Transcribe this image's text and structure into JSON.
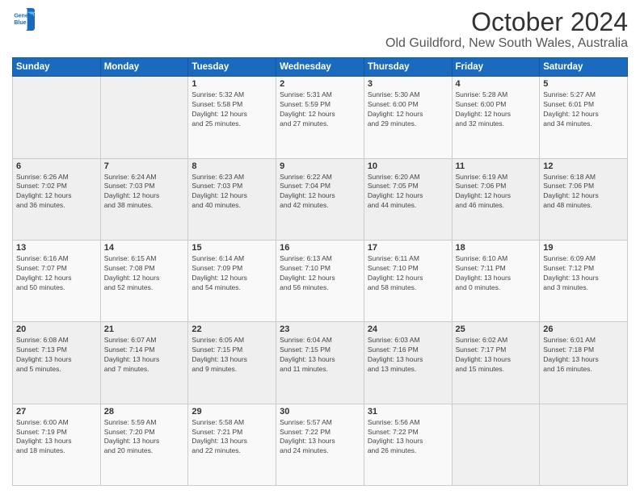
{
  "logo": {
    "line1": "General",
    "line2": "Blue"
  },
  "title": "October 2024",
  "subtitle": "Old Guildford, New South Wales, Australia",
  "weekdays": [
    "Sunday",
    "Monday",
    "Tuesday",
    "Wednesday",
    "Thursday",
    "Friday",
    "Saturday"
  ],
  "weeks": [
    [
      {
        "day": "",
        "text": ""
      },
      {
        "day": "",
        "text": ""
      },
      {
        "day": "1",
        "text": "Sunrise: 5:32 AM\nSunset: 5:58 PM\nDaylight: 12 hours\nand 25 minutes."
      },
      {
        "day": "2",
        "text": "Sunrise: 5:31 AM\nSunset: 5:59 PM\nDaylight: 12 hours\nand 27 minutes."
      },
      {
        "day": "3",
        "text": "Sunrise: 5:30 AM\nSunset: 6:00 PM\nDaylight: 12 hours\nand 29 minutes."
      },
      {
        "day": "4",
        "text": "Sunrise: 5:28 AM\nSunset: 6:00 PM\nDaylight: 12 hours\nand 32 minutes."
      },
      {
        "day": "5",
        "text": "Sunrise: 5:27 AM\nSunset: 6:01 PM\nDaylight: 12 hours\nand 34 minutes."
      }
    ],
    [
      {
        "day": "6",
        "text": "Sunrise: 6:26 AM\nSunset: 7:02 PM\nDaylight: 12 hours\nand 36 minutes."
      },
      {
        "day": "7",
        "text": "Sunrise: 6:24 AM\nSunset: 7:03 PM\nDaylight: 12 hours\nand 38 minutes."
      },
      {
        "day": "8",
        "text": "Sunrise: 6:23 AM\nSunset: 7:03 PM\nDaylight: 12 hours\nand 40 minutes."
      },
      {
        "day": "9",
        "text": "Sunrise: 6:22 AM\nSunset: 7:04 PM\nDaylight: 12 hours\nand 42 minutes."
      },
      {
        "day": "10",
        "text": "Sunrise: 6:20 AM\nSunset: 7:05 PM\nDaylight: 12 hours\nand 44 minutes."
      },
      {
        "day": "11",
        "text": "Sunrise: 6:19 AM\nSunset: 7:06 PM\nDaylight: 12 hours\nand 46 minutes."
      },
      {
        "day": "12",
        "text": "Sunrise: 6:18 AM\nSunset: 7:06 PM\nDaylight: 12 hours\nand 48 minutes."
      }
    ],
    [
      {
        "day": "13",
        "text": "Sunrise: 6:16 AM\nSunset: 7:07 PM\nDaylight: 12 hours\nand 50 minutes."
      },
      {
        "day": "14",
        "text": "Sunrise: 6:15 AM\nSunset: 7:08 PM\nDaylight: 12 hours\nand 52 minutes."
      },
      {
        "day": "15",
        "text": "Sunrise: 6:14 AM\nSunset: 7:09 PM\nDaylight: 12 hours\nand 54 minutes."
      },
      {
        "day": "16",
        "text": "Sunrise: 6:13 AM\nSunset: 7:10 PM\nDaylight: 12 hours\nand 56 minutes."
      },
      {
        "day": "17",
        "text": "Sunrise: 6:11 AM\nSunset: 7:10 PM\nDaylight: 12 hours\nand 58 minutes."
      },
      {
        "day": "18",
        "text": "Sunrise: 6:10 AM\nSunset: 7:11 PM\nDaylight: 13 hours\nand 0 minutes."
      },
      {
        "day": "19",
        "text": "Sunrise: 6:09 AM\nSunset: 7:12 PM\nDaylight: 13 hours\nand 3 minutes."
      }
    ],
    [
      {
        "day": "20",
        "text": "Sunrise: 6:08 AM\nSunset: 7:13 PM\nDaylight: 13 hours\nand 5 minutes."
      },
      {
        "day": "21",
        "text": "Sunrise: 6:07 AM\nSunset: 7:14 PM\nDaylight: 13 hours\nand 7 minutes."
      },
      {
        "day": "22",
        "text": "Sunrise: 6:05 AM\nSunset: 7:15 PM\nDaylight: 13 hours\nand 9 minutes."
      },
      {
        "day": "23",
        "text": "Sunrise: 6:04 AM\nSunset: 7:15 PM\nDaylight: 13 hours\nand 11 minutes."
      },
      {
        "day": "24",
        "text": "Sunrise: 6:03 AM\nSunset: 7:16 PM\nDaylight: 13 hours\nand 13 minutes."
      },
      {
        "day": "25",
        "text": "Sunrise: 6:02 AM\nSunset: 7:17 PM\nDaylight: 13 hours\nand 15 minutes."
      },
      {
        "day": "26",
        "text": "Sunrise: 6:01 AM\nSunset: 7:18 PM\nDaylight: 13 hours\nand 16 minutes."
      }
    ],
    [
      {
        "day": "27",
        "text": "Sunrise: 6:00 AM\nSunset: 7:19 PM\nDaylight: 13 hours\nand 18 minutes."
      },
      {
        "day": "28",
        "text": "Sunrise: 5:59 AM\nSunset: 7:20 PM\nDaylight: 13 hours\nand 20 minutes."
      },
      {
        "day": "29",
        "text": "Sunrise: 5:58 AM\nSunset: 7:21 PM\nDaylight: 13 hours\nand 22 minutes."
      },
      {
        "day": "30",
        "text": "Sunrise: 5:57 AM\nSunset: 7:22 PM\nDaylight: 13 hours\nand 24 minutes."
      },
      {
        "day": "31",
        "text": "Sunrise: 5:56 AM\nSunset: 7:22 PM\nDaylight: 13 hours\nand 26 minutes."
      },
      {
        "day": "",
        "text": ""
      },
      {
        "day": "",
        "text": ""
      }
    ]
  ]
}
